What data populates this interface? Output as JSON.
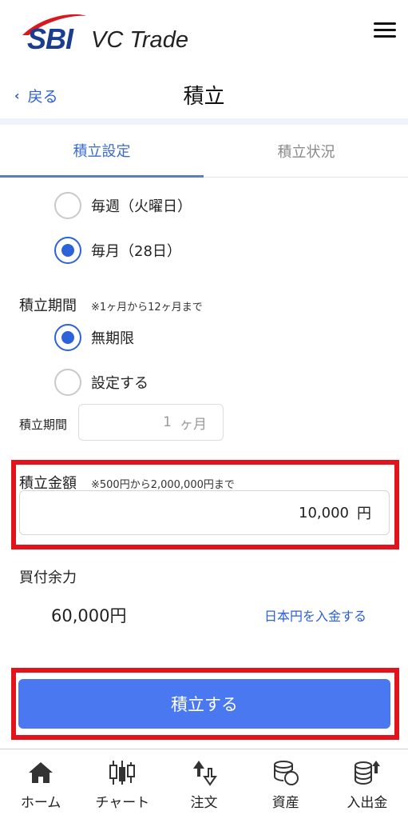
{
  "header": {
    "logo_sbi": "SBI",
    "logo_vc": "VC Trade",
    "back_label": "戻る",
    "title": "積立"
  },
  "tabs": [
    {
      "label": "積立設定",
      "active": true
    },
    {
      "label": "積立状況",
      "active": false
    }
  ],
  "frequency": {
    "weekly_label": "毎週（火曜日）",
    "monthly_label": "毎月（28日）",
    "selected": "monthly"
  },
  "period": {
    "title": "積立期間",
    "note": "※1ヶ月から12ヶ月まで",
    "unlimited_label": "無期限",
    "custom_label": "設定する",
    "selected": "unlimited",
    "field_label": "積立期間",
    "field_value": "1",
    "field_unit": "ヶ月"
  },
  "amount": {
    "title": "積立金額",
    "note": "※500円から2,000,000円まで",
    "value": "10,000",
    "unit": "円"
  },
  "buying_power": {
    "title": "買付余力",
    "value": "60,000円",
    "deposit_link": "日本円を入金する"
  },
  "submit_label": "積立する",
  "bottom_nav": [
    {
      "label": "ホーム",
      "icon": "home-icon"
    },
    {
      "label": "チャート",
      "icon": "chart-icon"
    },
    {
      "label": "注文",
      "icon": "order-icon"
    },
    {
      "label": "資産",
      "icon": "assets-icon"
    },
    {
      "label": "入出金",
      "icon": "deposit-withdraw-icon"
    }
  ],
  "colors": {
    "accent": "#2d63d8",
    "button": "#4a78f1",
    "highlight": "#e3131b",
    "logo": "#1a3d8f",
    "logo_swoosh": "#d7191f"
  }
}
